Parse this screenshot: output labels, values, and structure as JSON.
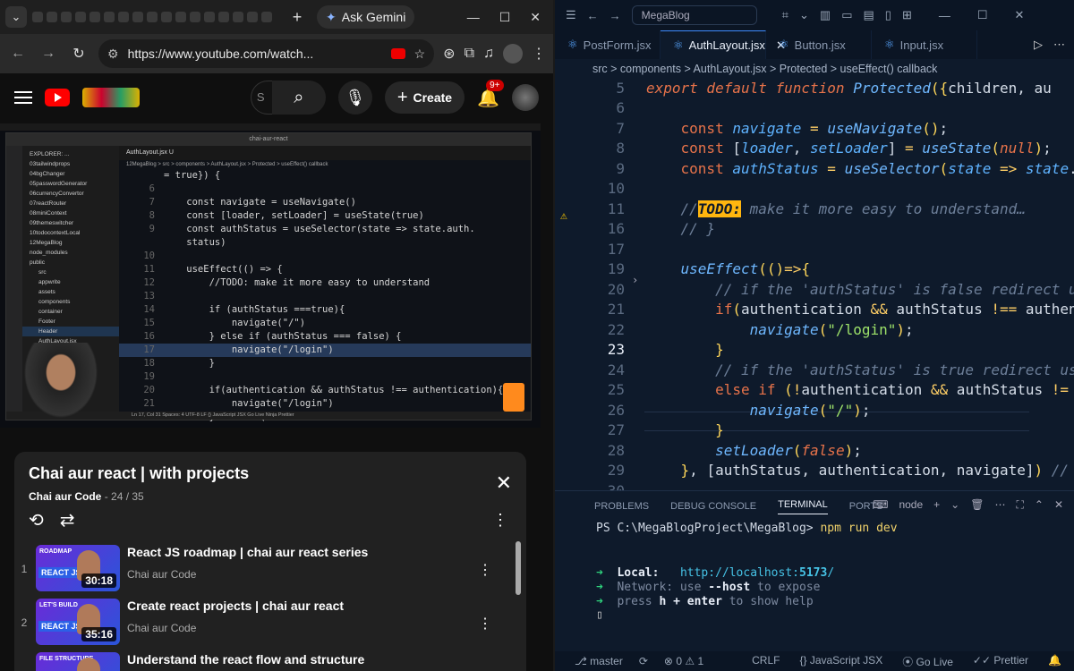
{
  "browser": {
    "gemini_label": "Ask Gemini",
    "url": "https://www.youtube.com/watch...",
    "youtube": {
      "search_placeholder": "S",
      "create_label": "Create",
      "notification_count": "9+"
    },
    "video": {
      "window_title": "chai-aur-react",
      "tab": "AuthLayout.jsx U",
      "breadcrumb": "12MegaBlog > src > components > AuthLayout.jsx > Protected > useEffect() callback",
      "status": "Ln 17, Col 31   Spaces: 4   UTF-8   LF   {} JavaScript JSX   Go Live   Ninja   Prettier",
      "explorer": [
        "EXPLORER: ...",
        "03tailwindprops",
        "04bgChanger",
        "05passwordGenerator",
        "06currencyConvertor",
        "07reactRouter",
        "08miniContext",
        "09themeswitcher",
        "10todocontextLocal",
        "12MegaBlog",
        "node_modules",
        "public",
        "src",
        "appwrite",
        "assets",
        "components",
        "container",
        "Footer",
        "Header",
        "AuthLayout.jsx",
        "Button.jsx",
        "index.js",
        "jsx",
        "jsx",
        "jsx"
      ],
      "code": [
        {
          "n": "",
          "t": "= true}) {"
        },
        {
          "n": "6",
          "t": ""
        },
        {
          "n": "7",
          "t": "    const navigate = useNavigate()"
        },
        {
          "n": "8",
          "t": "    const [loader, setLoader] = useState(true)"
        },
        {
          "n": "9",
          "t": "    const authStatus = useSelector(state => state.auth."
        },
        {
          "n": "",
          "t": "    status)"
        },
        {
          "n": "10",
          "t": ""
        },
        {
          "n": "11",
          "t": "    useEffect(() => {"
        },
        {
          "n": "12",
          "t": "        //TODO: make it more easy to understand"
        },
        {
          "n": "13",
          "t": ""
        },
        {
          "n": "14",
          "t": "        if (authStatus ===true){"
        },
        {
          "n": "15",
          "t": "            navigate(\"/\")"
        },
        {
          "n": "16",
          "t": "        } else if (authStatus === false) {"
        },
        {
          "n": "17",
          "t": "            navigate(\"/login\")"
        },
        {
          "n": "18",
          "t": "        }"
        },
        {
          "n": "19",
          "t": ""
        },
        {
          "n": "20",
          "t": "        if(authentication && authStatus !== authentication){"
        },
        {
          "n": "21",
          "t": "            navigate(\"/login\")"
        },
        {
          "n": "22",
          "t": "        } else if(!authentication && authStatus !=="
        }
      ]
    },
    "playlist": {
      "title": "Chai aur react | with projects",
      "channel": "Chai aur Code",
      "position": "- 24 / 35",
      "items": [
        {
          "index": "1",
          "title": "React JS roadmap | chai aur react series",
          "channel": "Chai aur Code",
          "duration": "30:18",
          "tag": "ROADMAP",
          "badge": "REACT JS"
        },
        {
          "index": "2",
          "title": "Create react projects | chai aur react",
          "channel": "Chai aur Code",
          "duration": "35:16",
          "tag": "LET'S BUILD",
          "badge": "REACT JS"
        },
        {
          "index": "",
          "title": "Understand the react flow and structure",
          "channel": "",
          "duration": "",
          "tag": "FILE STRUCTURE",
          "badge": ""
        }
      ]
    }
  },
  "vscode": {
    "search": "MegaBlog",
    "tabs": [
      "PostForm.jsx",
      "AuthLayout.jsx",
      "Button.jsx",
      "Input.jsx"
    ],
    "breadcrumb": "src > components > AuthLayout.jsx > Protected > useEffect() callback",
    "panel_tabs": [
      "PROBLEMS",
      "DEBUG CONSOLE",
      "TERMINAL",
      "PORTS"
    ],
    "terminal_name": "node",
    "terminal": {
      "prompt": "PS C:\\MegaBlogProject\\MegaBlog> ",
      "command": "npm run dev",
      "local_label": "Local:",
      "local_url": "http://localhost:",
      "local_port": "5173",
      "network": "Network: use ",
      "network_flag": "--host",
      "network_rest": " to expose",
      "help_pre": "press ",
      "help_key": "h + enter",
      "help_rest": " to show help"
    },
    "status": {
      "branch": "master",
      "errors": "0",
      "warnings": "1",
      "crlf": "CRLF",
      "language": "JavaScript JSX",
      "golive": "Go Live",
      "prettier": "Prettier"
    },
    "code_lines": [
      {
        "n": "5"
      },
      {
        "n": "6"
      },
      {
        "n": "7"
      },
      {
        "n": "8"
      },
      {
        "n": "9"
      },
      {
        "n": "10"
      },
      {
        "n": "11"
      },
      {
        "n": "16"
      },
      {
        "n": "17"
      },
      {
        "n": "19"
      },
      {
        "n": "20"
      },
      {
        "n": "21"
      },
      {
        "n": "22"
      },
      {
        "n": "23"
      },
      {
        "n": "24"
      },
      {
        "n": "25"
      },
      {
        "n": "26"
      },
      {
        "n": "27"
      },
      {
        "n": "28"
      },
      {
        "n": "29"
      },
      {
        "n": "30"
      }
    ]
  }
}
